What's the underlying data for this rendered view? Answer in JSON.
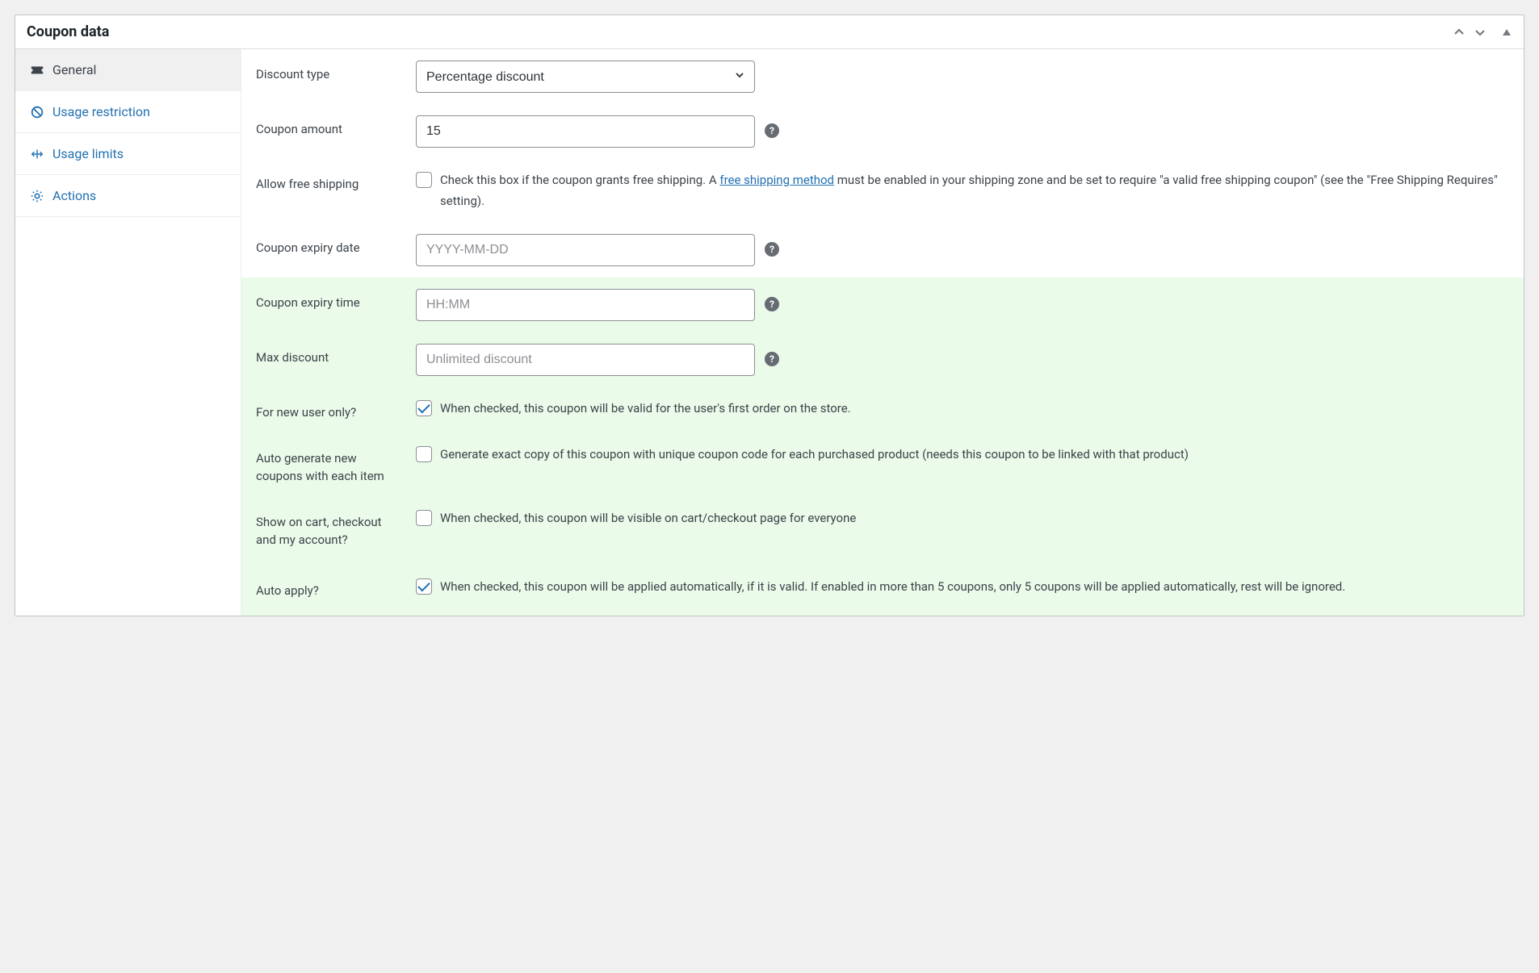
{
  "panel": {
    "title": "Coupon data"
  },
  "sidebar": {
    "items": [
      {
        "label": "General"
      },
      {
        "label": "Usage restriction"
      },
      {
        "label": "Usage limits"
      },
      {
        "label": "Actions"
      }
    ]
  },
  "fields": {
    "discount_type": {
      "label": "Discount type",
      "value": "Percentage discount"
    },
    "coupon_amount": {
      "label": "Coupon amount",
      "value": "15"
    },
    "allow_free_shipping": {
      "label": "Allow free shipping",
      "desc_prefix": "Check this box if the coupon grants free shipping. A ",
      "link_text": "free shipping method",
      "desc_suffix": " must be enabled in your shipping zone and be set to require \"a valid free shipping coupon\" (see the \"Free Shipping Requires\" setting)."
    },
    "coupon_expiry_date": {
      "label": "Coupon expiry date",
      "placeholder": "YYYY-MM-DD"
    },
    "coupon_expiry_time": {
      "label": "Coupon expiry time",
      "placeholder": "HH:MM"
    },
    "max_discount": {
      "label": "Max discount",
      "placeholder": "Unlimited discount"
    },
    "for_new_user": {
      "label": "For new user only?",
      "desc": "When checked, this coupon will be valid for the user's first order on the store."
    },
    "auto_generate": {
      "label": "Auto generate new coupons with each item",
      "desc": "Generate exact copy of this coupon with unique coupon code for each purchased product (needs this coupon to be linked with that product)"
    },
    "show_on_cart": {
      "label": "Show on cart, checkout and my account?",
      "desc": "When checked, this coupon will be visible on cart/checkout page for everyone"
    },
    "auto_apply": {
      "label": "Auto apply?",
      "desc": "When checked, this coupon will be applied automatically, if it is valid. If enabled in more than 5 coupons, only 5 coupons will be applied automatically, rest will be ignored."
    }
  }
}
